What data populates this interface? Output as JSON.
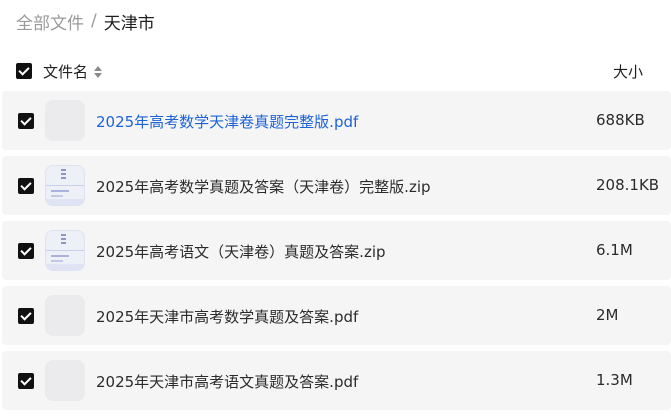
{
  "breadcrumb": {
    "root": "全部文件",
    "separator": "/",
    "current": "天津市"
  },
  "header": {
    "name_label": "文件名",
    "size_label": "大小",
    "select_all_checked": true,
    "sort_icon": "sort-up-down-icon"
  },
  "files": [
    {
      "name": "2025年高考数学天津卷真题完整版.pdf",
      "size": "688KB",
      "type": "pdf",
      "checked": true,
      "highlighted": true
    },
    {
      "name": "2025年高考数学真题及答案（天津卷）完整版.zip",
      "size": "208.1KB",
      "type": "zip",
      "checked": true,
      "highlighted": false
    },
    {
      "name": "2025年高考语文（天津卷）真题及答案.zip",
      "size": "6.1M",
      "type": "zip",
      "checked": true,
      "highlighted": false
    },
    {
      "name": "2025年天津市高考数学真题及答案.pdf",
      "size": "2M",
      "type": "pdf",
      "checked": true,
      "highlighted": false
    },
    {
      "name": "2025年天津市高考语文真题及答案.pdf",
      "size": "1.3M",
      "type": "pdf",
      "checked": true,
      "highlighted": false
    }
  ],
  "colors": {
    "link": "#1d63d6",
    "row_bg": "#f5f5f6",
    "checkbox": "#111111",
    "muted": "#9a9a9a"
  }
}
